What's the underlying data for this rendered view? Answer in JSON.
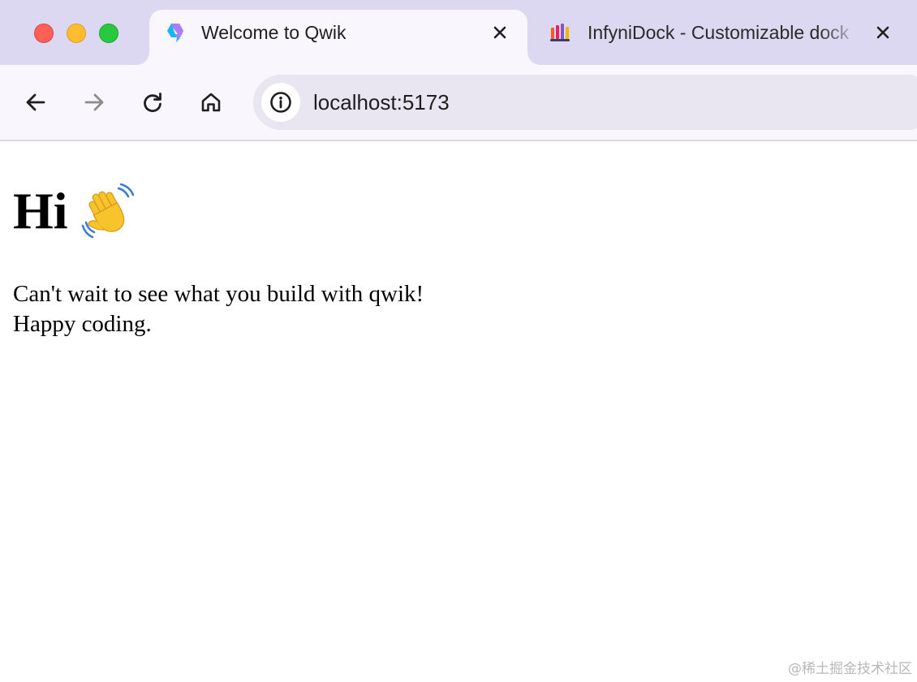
{
  "window": {
    "traffic_lights": [
      "close",
      "minimize",
      "maximize"
    ]
  },
  "tabs": [
    {
      "title": "Welcome to Qwik",
      "favicon": "qwik-logo-icon",
      "active": true
    },
    {
      "title": "InfyniDock - Customizable dock",
      "favicon": "infynidock-logo-icon",
      "active": false
    }
  ],
  "toolbar": {
    "back_icon": "arrow-left-icon",
    "forward_icon": "arrow-right-icon",
    "reload_icon": "reload-icon",
    "home_icon": "home-icon",
    "site_info_icon": "info-icon",
    "url": "localhost:5173"
  },
  "page": {
    "heading": "Hi",
    "heading_emoji": "waving-hand-icon",
    "line1": "Can't wait to see what you build with qwik!",
    "line2": "Happy coding."
  },
  "watermark": "@稀土掘金技术社区",
  "colors": {
    "tabstrip": "#dcd8f2",
    "active_tab": "#f9f6fd",
    "omnibox": "#e9e5f1",
    "close": "#fe5f57",
    "minimize": "#febc2e",
    "maximize": "#28c840"
  }
}
